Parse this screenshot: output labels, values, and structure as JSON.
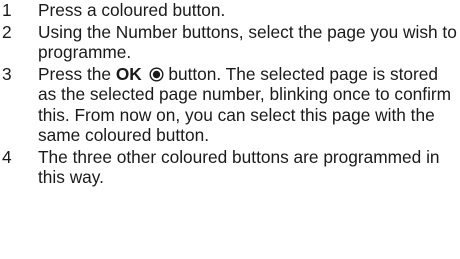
{
  "steps": [
    {
      "number": "1",
      "text": "Press a coloured button."
    },
    {
      "number": "2",
      "text": "Using the Number buttons, select the page you wish to programme."
    },
    {
      "number": "3",
      "text_before": "Press the ",
      "ok_label": "OK",
      "ok_icon": "ok-button-icon",
      "text_after": " button. The selected page is stored as the selected page number, blinking once to confirm this. From now on, you can select this page with the same coloured button."
    },
    {
      "number": "4",
      "text": "The three other coloured buttons are programmed in this way."
    }
  ]
}
